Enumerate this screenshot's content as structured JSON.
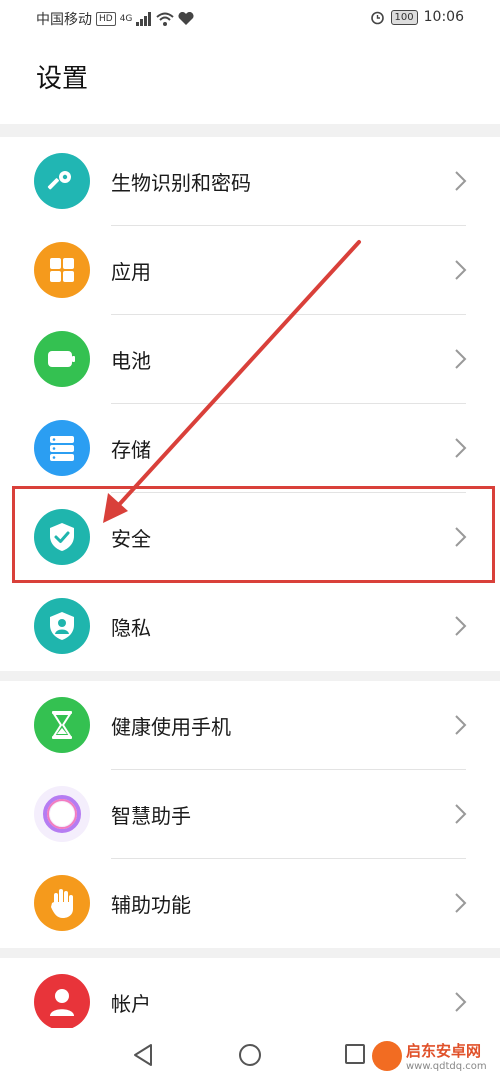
{
  "status_bar": {
    "carrier": "中国移动",
    "hd": "HD",
    "network": "4G",
    "battery": "100",
    "time": "10:06"
  },
  "header": {
    "title": "设置"
  },
  "groups": [
    {
      "items": [
        {
          "label": "生物识别和密码",
          "icon": "key-icon",
          "color": "#21b6b3"
        },
        {
          "label": "应用",
          "icon": "apps-grid-icon",
          "color": "#f59a1c"
        },
        {
          "label": "电池",
          "icon": "battery-icon",
          "color": "#34c151"
        },
        {
          "label": "存储",
          "icon": "storage-icon",
          "color": "#2b9ef2"
        },
        {
          "label": "安全",
          "icon": "shield-check-icon",
          "color": "#1fb5ad"
        },
        {
          "label": "隐私",
          "icon": "privacy-shield-icon",
          "color": "#1fb5ad"
        }
      ]
    },
    {
      "items": [
        {
          "label": "健康使用手机",
          "icon": "hourglass-icon",
          "color": "#34c151"
        },
        {
          "label": "智慧助手",
          "icon": "assistant-ring-icon",
          "color": "#b57cf2"
        },
        {
          "label": "辅助功能",
          "icon": "hand-icon",
          "color": "#f59a1c"
        }
      ]
    },
    {
      "items": [
        {
          "label": "帐户",
          "icon": "user-icon",
          "color": "#e8343a"
        }
      ]
    }
  ],
  "highlight_color": "#d9403a",
  "watermark": {
    "main": "启东安卓网",
    "sub": "www.qdtdq.com"
  }
}
